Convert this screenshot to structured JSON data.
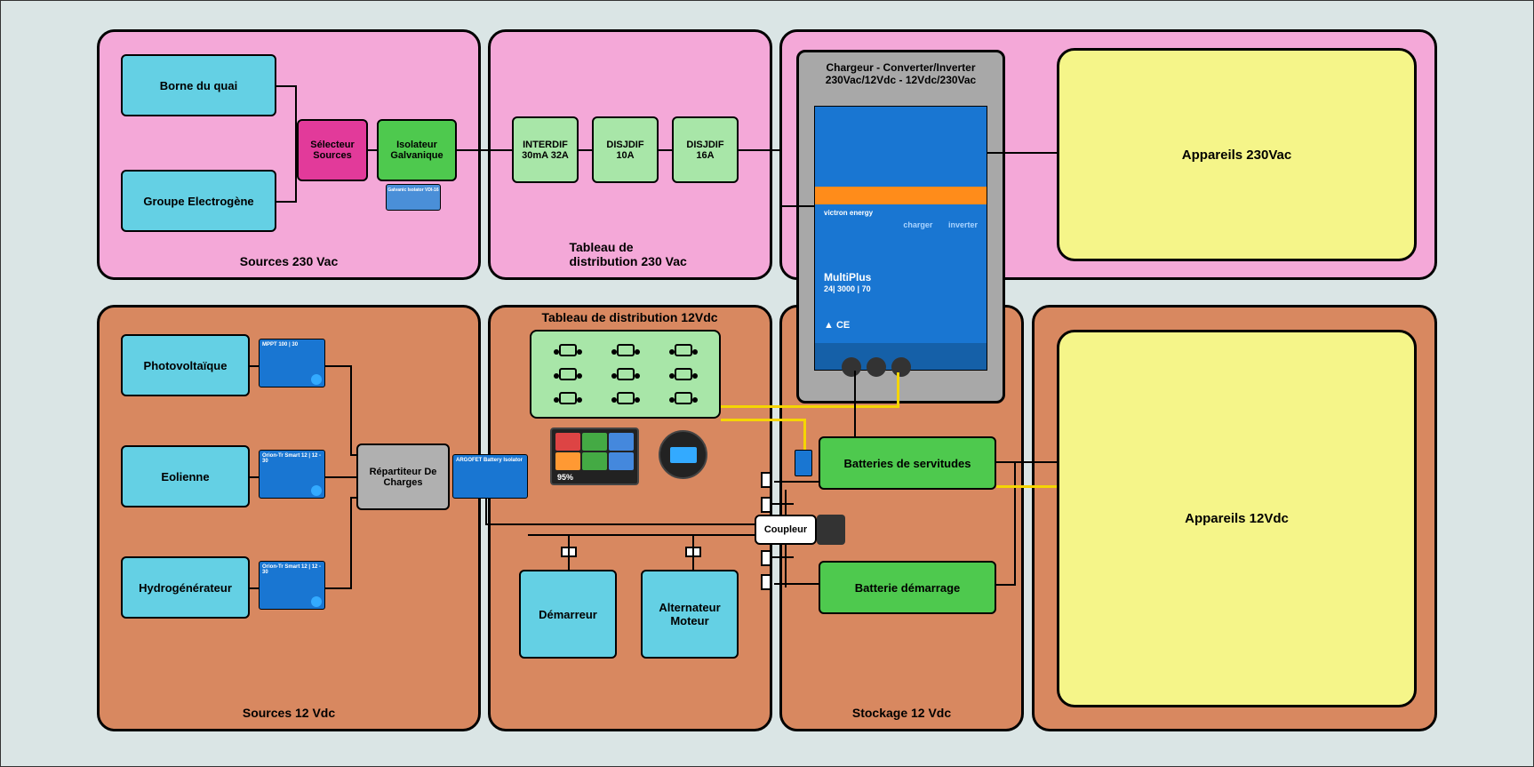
{
  "zones": {
    "sources_230": "Sources 230 Vac",
    "tableau_230": "Tableau de distribution 230 Vac",
    "sources_12": "Sources 12 Vdc",
    "tableau_12": "Tableau de distribution 12Vdc",
    "stockage_12": "Stockage 12 Vdc",
    "appareils_230": "Appareils 230Vac",
    "appareils_12": "Appareils 12Vdc"
  },
  "boxes": {
    "borne_quai": "Borne du quai",
    "groupe_electro": "Groupe Electrogène",
    "selecteur": "Sélecteur Sources",
    "isolateur": "Isolateur Galvanique",
    "interdif": "INTERDIF 30mA 32A",
    "disjdif_10": "DISJDIF 10A",
    "disjdif_16": "DISJDIF 16A",
    "photovoltaique": "Photovoltaïque",
    "eolienne": "Eolienne",
    "hydrogenerateur": "Hydrogénérateur",
    "repartiteur": "Répartiteur De Charges",
    "demarreur": "Démarreur",
    "alternateur": "Alternateur Moteur",
    "coupleur": "Coupleur",
    "batteries_servitudes": "Batteries de servitudes",
    "batterie_demarrage": "Batterie démarrage"
  },
  "charger": {
    "line1": "Chargeur - Converter/Inverter",
    "line2": "230Vac/12Vdc - 12Vdc/230Vac",
    "brand": "victron energy",
    "model": "MultiPlus",
    "spec": "24| 3000 | 70",
    "charger_label": "charger",
    "inverter_label": "inverter"
  },
  "devices": {
    "mppt": "MPPT 100 | 30",
    "orion1": "Orion-Tr Smart 12 | 12 - 30",
    "orion2": "Orion-Tr Smart 12 | 12 - 30",
    "argofet": "ARGOFET Battery Isolator",
    "galv_iso": "Galvanic Isolator VDI-16"
  },
  "display": {
    "pct": "95%"
  }
}
